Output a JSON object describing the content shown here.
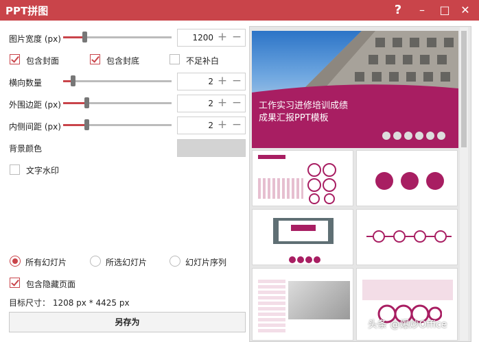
{
  "window": {
    "title": "PPT拼图",
    "help": "?",
    "min": "–",
    "max": "□",
    "close": "✕"
  },
  "settings": {
    "image_width": {
      "label": "图片宽度 (px)",
      "value": "1200",
      "slider_fraction": 0.12
    },
    "include_cover": {
      "label": "包含封面",
      "checked": true
    },
    "include_back": {
      "label": "包含封底",
      "checked": true
    },
    "fill_blank": {
      "label": "不足补白",
      "checked": false
    },
    "horizontal_count": {
      "label": "横向数量",
      "value": "2",
      "slider_fraction": 0.05
    },
    "outer_margin": {
      "label": "外围边距 (px)",
      "value": "2",
      "slider_fraction": 0.05
    },
    "inner_spacing": {
      "label": "内侧间距 (px)",
      "value": "2",
      "slider_fraction": 0.05
    },
    "bg_color": {
      "label": "背景颜色",
      "value": "#d3d3d3"
    },
    "text_watermark": {
      "label": "文字水印",
      "checked": false
    }
  },
  "scope": {
    "all": {
      "label": "所有幻灯片",
      "selected": true
    },
    "selected": {
      "label": "所选幻灯片",
      "selected": false
    },
    "sequence": {
      "label": "幻灯片序列",
      "selected": false
    }
  },
  "include_hidden": {
    "label": "包含隐藏页面",
    "checked": true
  },
  "target_size": "目标尺寸： 1208 px *  4425 px",
  "save_as": "另存为",
  "preview": {
    "cover_title_1": "工作实习进修培训成绩",
    "cover_title_2": "成果汇报PPT模板"
  },
  "watermark": "头条 @爆炒Office",
  "colors": {
    "accent": "#c9444a",
    "slide_accent": "#a81e62"
  }
}
